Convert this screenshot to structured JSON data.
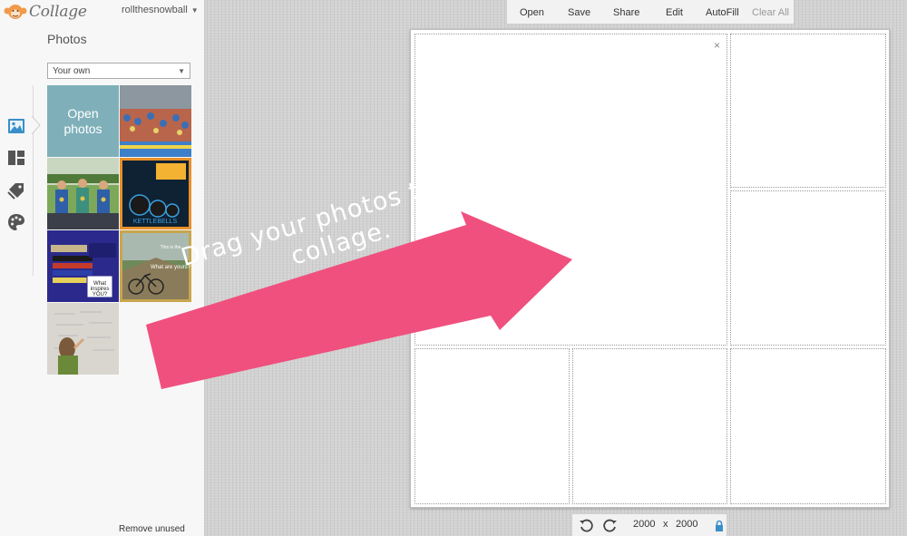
{
  "app": {
    "logo_text": "Collage",
    "username": "rollthesnowball"
  },
  "sidebar": {
    "panel_title": "Photos",
    "source_select": {
      "value": "Your own"
    },
    "open_photos_label": "Open\nphotos",
    "tools": [
      {
        "icon": "image-icon"
      },
      {
        "icon": "layout-icon"
      },
      {
        "icon": "tag-icon"
      },
      {
        "icon": "palette-icon"
      }
    ],
    "remove_unused_label": "Remove unused",
    "thumbnails": [
      {
        "icon": "photo-runners-crowd"
      },
      {
        "icon": "photo-three-runners-medals"
      },
      {
        "icon": "photo-kettlebells-poster",
        "caption": "KETTLEBELLS"
      },
      {
        "icon": "photo-black-belt-quote",
        "caption": "What inspires YOU?"
      },
      {
        "icon": "photo-mountain-bike-quote",
        "caption": "What are yours?"
      },
      {
        "icon": "photo-girl-writing-wall"
      }
    ]
  },
  "toolbar": {
    "open": "Open",
    "save": "Save",
    "share": "Share",
    "edit": "Edit",
    "autofill": "AutoFill",
    "clear_all": "Clear All"
  },
  "canvas": {
    "close_glyph": "×"
  },
  "bottombar": {
    "width": "2000",
    "times": "x",
    "height": "2000"
  },
  "overlay": {
    "line1": "Drag your photos to the",
    "line2": "collage.",
    "color": "#f0507e"
  },
  "colors": {
    "open_photos_bg": "#7fb0ba",
    "accent_arrow": "#f0507e"
  }
}
